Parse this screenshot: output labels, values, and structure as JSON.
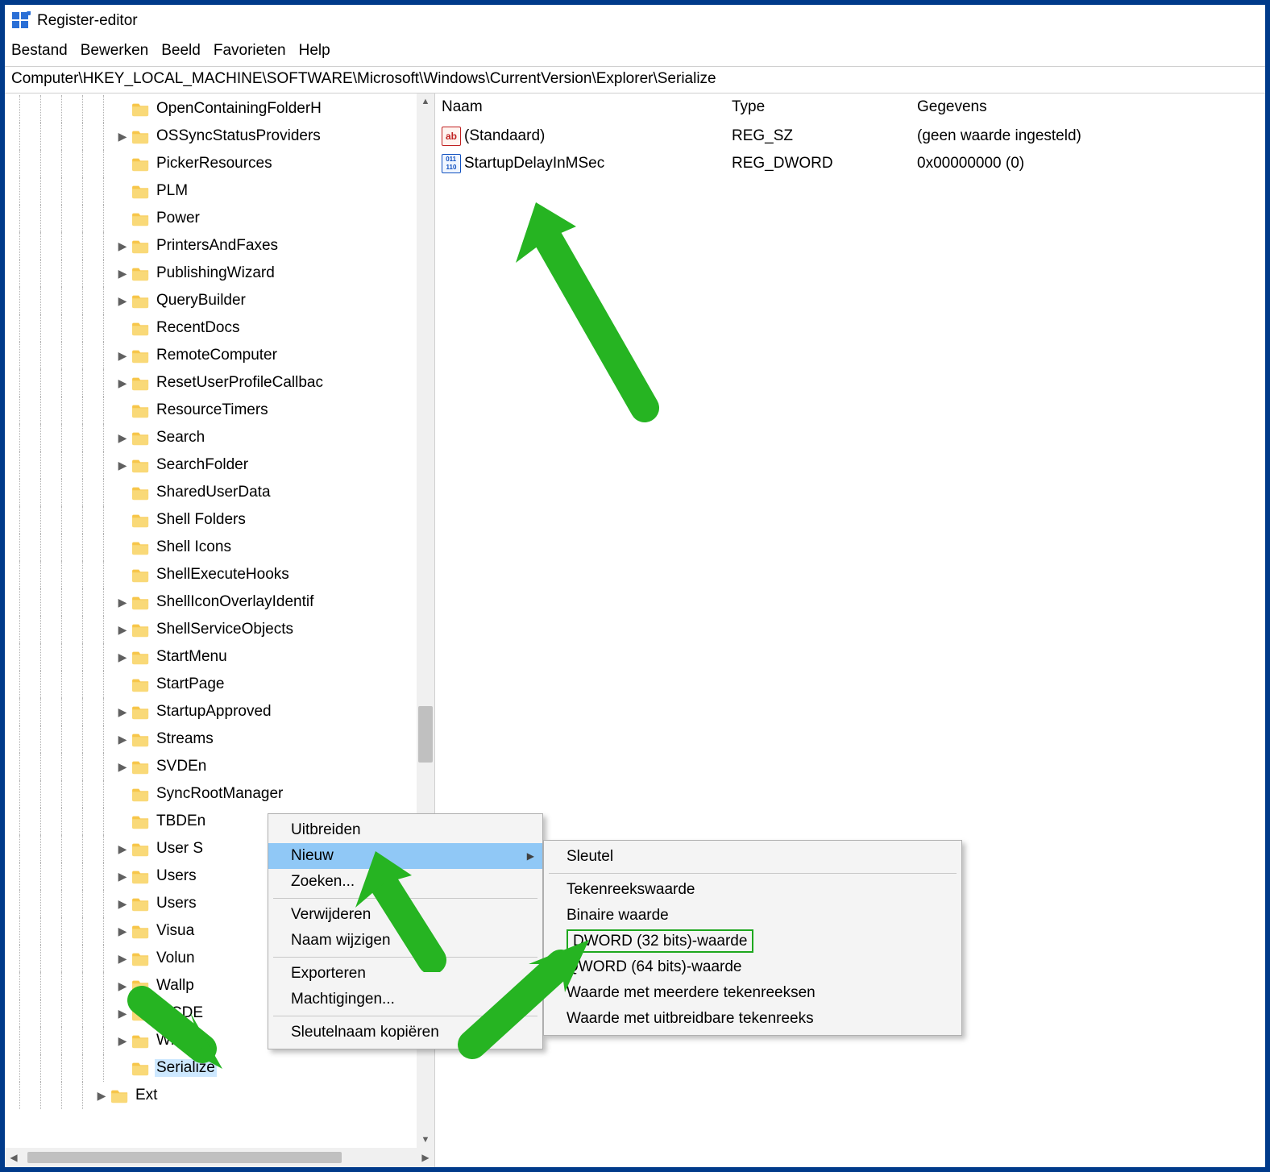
{
  "app": {
    "title": "Register-editor"
  },
  "menubar": {
    "items": [
      "Bestand",
      "Bewerken",
      "Beeld",
      "Favorieten",
      "Help"
    ]
  },
  "addressbar": {
    "path": "Computer\\HKEY_LOCAL_MACHINE\\SOFTWARE\\Microsoft\\Windows\\CurrentVersion\\Explorer\\Serialize"
  },
  "tree": {
    "nodes": [
      {
        "label": "OpenContainingFolderH",
        "exp": "",
        "depth": 5
      },
      {
        "label": "OSSyncStatusProviders",
        "exp": ">",
        "depth": 5
      },
      {
        "label": "PickerResources",
        "exp": "",
        "depth": 5
      },
      {
        "label": "PLM",
        "exp": "",
        "depth": 5
      },
      {
        "label": "Power",
        "exp": "",
        "depth": 5
      },
      {
        "label": "PrintersAndFaxes",
        "exp": ">",
        "depth": 5
      },
      {
        "label": "PublishingWizard",
        "exp": ">",
        "depth": 5
      },
      {
        "label": "QueryBuilder",
        "exp": ">",
        "depth": 5
      },
      {
        "label": "RecentDocs",
        "exp": "",
        "depth": 5
      },
      {
        "label": "RemoteComputer",
        "exp": ">",
        "depth": 5
      },
      {
        "label": "ResetUserProfileCallbac",
        "exp": ">",
        "depth": 5
      },
      {
        "label": "ResourceTimers",
        "exp": "",
        "depth": 5
      },
      {
        "label": "Search",
        "exp": ">",
        "depth": 5
      },
      {
        "label": "SearchFolder",
        "exp": ">",
        "depth": 5
      },
      {
        "label": "SharedUserData",
        "exp": "",
        "depth": 5
      },
      {
        "label": "Shell Folders",
        "exp": "",
        "depth": 5
      },
      {
        "label": "Shell Icons",
        "exp": "",
        "depth": 5
      },
      {
        "label": "ShellExecuteHooks",
        "exp": "",
        "depth": 5
      },
      {
        "label": "ShellIconOverlayIdentif",
        "exp": ">",
        "depth": 5
      },
      {
        "label": "ShellServiceObjects",
        "exp": ">",
        "depth": 5
      },
      {
        "label": "StartMenu",
        "exp": ">",
        "depth": 5
      },
      {
        "label": "StartPage",
        "exp": "",
        "depth": 5
      },
      {
        "label": "StartupApproved",
        "exp": ">",
        "depth": 5
      },
      {
        "label": "Streams",
        "exp": ">",
        "depth": 5
      },
      {
        "label": "SVDEn",
        "exp": ">",
        "depth": 5
      },
      {
        "label": "SyncRootManager",
        "exp": "",
        "depth": 5
      },
      {
        "label": "TBDEn",
        "exp": "",
        "depth": 5
      },
      {
        "label": "User S",
        "exp": ">",
        "depth": 5
      },
      {
        "label": "Users",
        "exp": ">",
        "depth": 5
      },
      {
        "label": "Users",
        "exp": ">",
        "depth": 5
      },
      {
        "label": "Visua",
        "exp": ">",
        "depth": 5
      },
      {
        "label": "Volun",
        "exp": ">",
        "depth": 5
      },
      {
        "label": "Wallp",
        "exp": ">",
        "depth": 5
      },
      {
        "label": "WCDE",
        "exp": ">",
        "depth": 5
      },
      {
        "label": "Windo",
        "exp": ">",
        "depth": 5
      },
      {
        "label": "Serialize",
        "exp": "",
        "depth": 5,
        "selected": true
      },
      {
        "label": "Ext",
        "exp": ">",
        "depth": 4
      }
    ]
  },
  "list": {
    "headers": {
      "name": "Naam",
      "type": "Type",
      "data": "Gegevens"
    },
    "rows": [
      {
        "icon": "str",
        "name": "(Standaard)",
        "type": "REG_SZ",
        "data": "(geen waarde ingesteld)"
      },
      {
        "icon": "bin",
        "name": "StartupDelayInMSec",
        "type": "REG_DWORD",
        "data": "0x00000000 (0)"
      }
    ]
  },
  "context1": {
    "items": [
      {
        "label": "Uitbreiden"
      },
      {
        "label": "Nieuw",
        "hover": true,
        "sub": true
      },
      {
        "label": "Zoeken..."
      },
      {
        "sep": true
      },
      {
        "label": "Verwijderen"
      },
      {
        "label": "Naam wijzigen"
      },
      {
        "sep": true
      },
      {
        "label": "Exporteren"
      },
      {
        "label": "Machtigingen..."
      },
      {
        "sep": true
      },
      {
        "label": "Sleutelnaam kopiëren"
      }
    ]
  },
  "context2": {
    "items": [
      {
        "label": "Sleutel"
      },
      {
        "sep": true
      },
      {
        "label": "Tekenreekswaarde"
      },
      {
        "label": "Binaire waarde"
      },
      {
        "label": "DWORD (32 bits)-waarde",
        "boxed": true
      },
      {
        "label": "QWORD (64 bits)-waarde"
      },
      {
        "label": "Waarde met meerdere tekenreeksen"
      },
      {
        "label": "Waarde met uitbreidbare tekenreeks"
      }
    ]
  }
}
